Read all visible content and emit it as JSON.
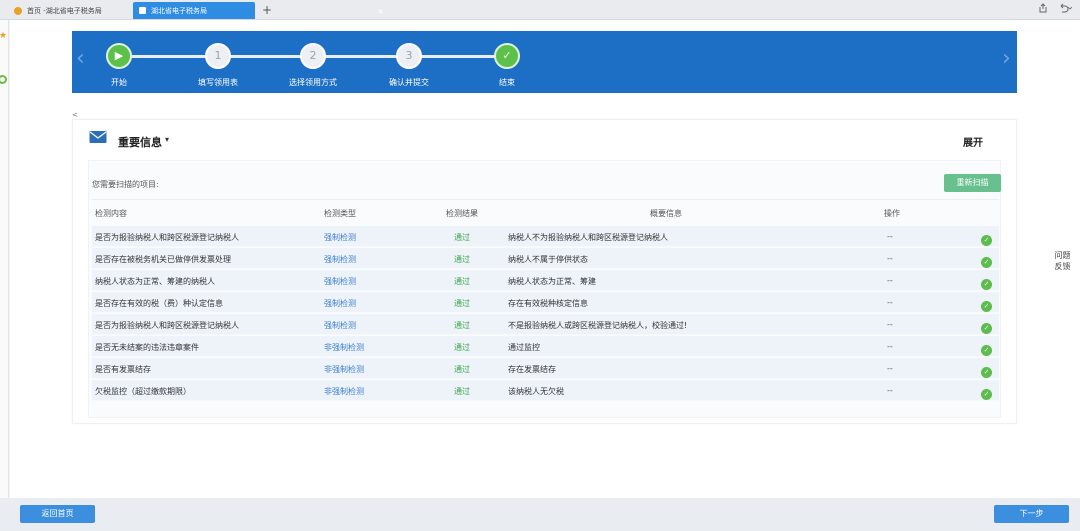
{
  "browser": {
    "tabs": [
      {
        "label": "首页 -湖北省电子税务局"
      },
      {
        "label": "湖北省电子税务局"
      }
    ],
    "close_glyph": "×",
    "add_glyph": "+"
  },
  "wizard": {
    "steps": [
      {
        "label": "开始",
        "marker": "▶",
        "state": "done"
      },
      {
        "label": "填写领用表",
        "marker": "1",
        "state": "pending"
      },
      {
        "label": "选择领用方式",
        "marker": "2",
        "state": "pending"
      },
      {
        "label": "确认并提交",
        "marker": "3",
        "state": "pending"
      },
      {
        "label": "结束",
        "marker": "✓",
        "state": "done"
      }
    ],
    "prev_glyph": "‹",
    "next_glyph": "›"
  },
  "small_marker": "<",
  "info": {
    "title": "重要信息",
    "caret": "▾",
    "expand_label": "展开",
    "scan_label": "您需要扫描的项目:",
    "rescan_label": "重新扫描",
    "headers": [
      "检测内容",
      "检测类型",
      "检测结果",
      "概要信息",
      "操作"
    ],
    "rows": [
      {
        "item": "是否为报验纳税人和跨区税源登记纳税人",
        "type": "强制检测",
        "result": "通过",
        "summary": "纳税人不为报验纳税人和跨区税源登记纳税人",
        "op": "--"
      },
      {
        "item": "是否存在被税务机关已做停供发票处理",
        "type": "强制检测",
        "result": "通过",
        "summary": "纳税人不属于停供状态",
        "op": "--"
      },
      {
        "item": "纳税人状态为正常、筹建的纳税人",
        "type": "强制检测",
        "result": "通过",
        "summary": "纳税人状态为正常、筹建",
        "op": "--"
      },
      {
        "item": "是否存在有效的税（费）种认定信息",
        "type": "强制检测",
        "result": "通过",
        "summary": "存在有效税种核定信息",
        "op": "--"
      },
      {
        "item": "是否为报验纳税人和跨区税源登记纳税人",
        "type": "强制检测",
        "result": "通过",
        "summary": "不是报验纳税人或跨区税源登记纳税人，校验通过!",
        "op": "--"
      },
      {
        "item": "是否无未结案的违法违章案件",
        "type": "非强制检测",
        "result": "通过",
        "summary": "通过监控",
        "op": "--"
      },
      {
        "item": "是否有发票结存",
        "type": "非强制检测",
        "result": "通过",
        "summary": "存在发票结存",
        "op": "--"
      },
      {
        "item": "欠税监控（超过缴款期限）",
        "type": "非强制检测",
        "result": "通过",
        "summary": "该纳税人无欠税",
        "op": "--"
      }
    ]
  },
  "feedback": {
    "line1": "问题",
    "line2": "反馈"
  },
  "footer": {
    "home_label": "返回首页",
    "next_label": "下一步"
  },
  "colors": {
    "wizard_bg": "#1c6fc4",
    "accent": "#3b8fde",
    "success": "#5cbc4c",
    "rescan": "#67c08d"
  }
}
